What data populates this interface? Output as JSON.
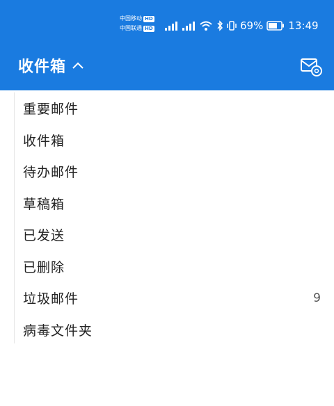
{
  "status_bar": {
    "carrier_1": "中国移动",
    "carrier_1_badge": "HD",
    "carrier_2": "中国联通",
    "carrier_2_badge": "HD",
    "battery_percent": "69%",
    "time": "13:49"
  },
  "app_bar": {
    "title": "收件箱",
    "compose_icon": "mail-settings-icon"
  },
  "folders": [
    {
      "label": "重要邮件",
      "count": ""
    },
    {
      "label": "收件箱",
      "count": ""
    },
    {
      "label": "待办邮件",
      "count": ""
    },
    {
      "label": "草稿箱",
      "count": ""
    },
    {
      "label": "已发送",
      "count": ""
    },
    {
      "label": "已删除",
      "count": ""
    },
    {
      "label": "垃圾邮件",
      "count": "9"
    },
    {
      "label": "病毒文件夹",
      "count": ""
    }
  ],
  "colors": {
    "header": "#1a7be0",
    "text": "#222222"
  }
}
